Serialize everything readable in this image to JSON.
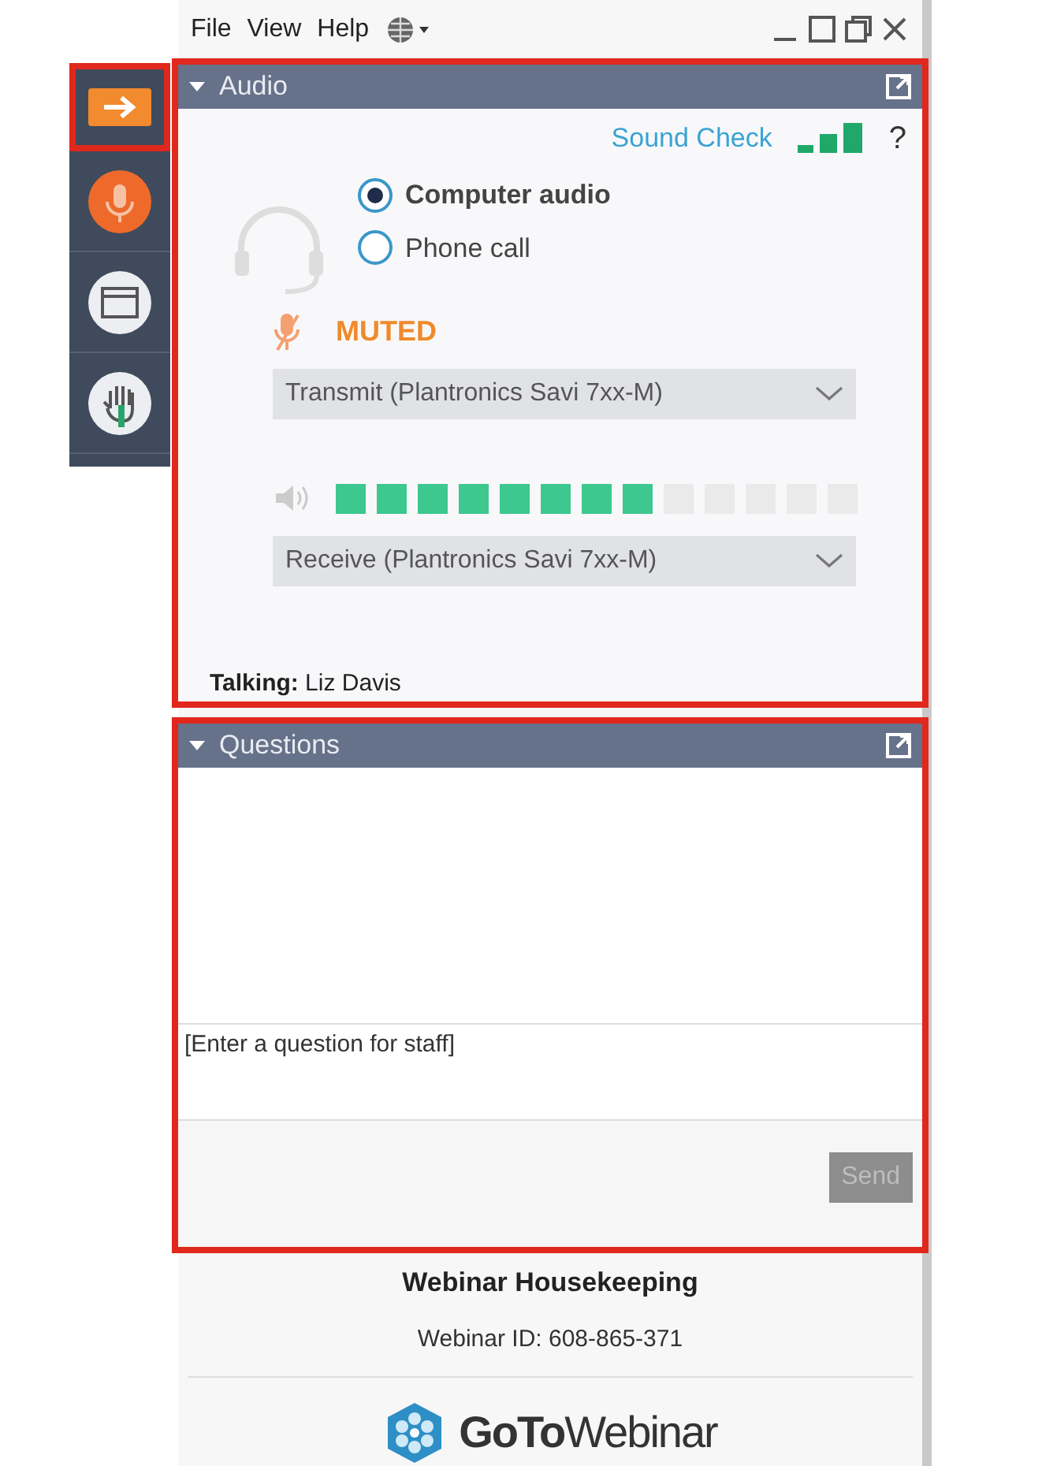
{
  "menu": [
    {
      "label": "File"
    },
    {
      "label": "View"
    },
    {
      "label": "Help"
    }
  ],
  "sidebar": [
    {
      "kind": "arrow",
      "highlighted": true
    },
    {
      "kind": "mic",
      "highlighted": false
    },
    {
      "kind": "window",
      "highlighted": false
    },
    {
      "kind": "hand",
      "highlighted": false
    }
  ],
  "audio_panel": {
    "title": "Audio",
    "highlighted": true,
    "sound_check": "Sound Check",
    "help": "?",
    "options": [
      {
        "label": "Computer audio",
        "selected": true
      },
      {
        "label": "Phone call",
        "selected": false
      }
    ],
    "mic_status": "MUTED",
    "transmit": "Transmit (Plantronics Savi 7xx-M)",
    "speaker": {
      "level": 0.615
    },
    "receive": "Receive (Plantronics Savi 7xx-M)",
    "talking": "**Talking:** Liz Davis"
  },
  "questions_panel": {
    "title": "Questions",
    "highlighted": true,
    "placeholder": "[Enter a question for staff]",
    "send": {
      "label": "Send",
      "disabled": true
    }
  },
  "footer": {
    "title": "Webinar Housekeeping",
    "webinar_id": "Webinar ID: 608-865-371",
    "logo": "**GoTo**Webinar"
  }
}
